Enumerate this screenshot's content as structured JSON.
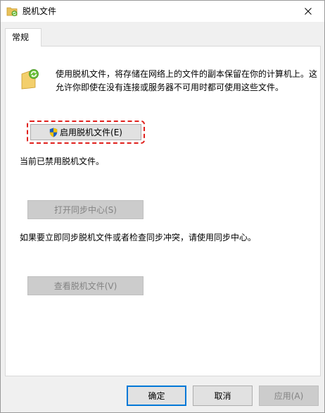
{
  "window": {
    "title": "脱机文件"
  },
  "tabs": [
    {
      "label": "常规",
      "selected": true
    }
  ],
  "general": {
    "description": "使用脱机文件，将存储在网络上的文件的副本保留在你的计算机上。这允许你即使在没有连接或服务器不可用时都可使用这些文件。",
    "enable_button": "启用脱机文件(E)",
    "status_text": "当前已禁用脱机文件。",
    "open_sync_button": "打开同步中心(S)",
    "sync_hint": "如果要立即同步脱机文件或者检查同步冲突，请使用同步中心。",
    "view_files_button": "查看脱机文件(V)"
  },
  "footer": {
    "ok": "确定",
    "cancel": "取消",
    "apply": "应用(A)"
  },
  "icons": {
    "title": "offline-files-icon",
    "close": "close-icon",
    "folder": "sync-folder-icon",
    "shield": "uac-shield-icon"
  },
  "colors": {
    "highlight_ring": "#e0201c",
    "default_button_border": "#0078d7"
  }
}
